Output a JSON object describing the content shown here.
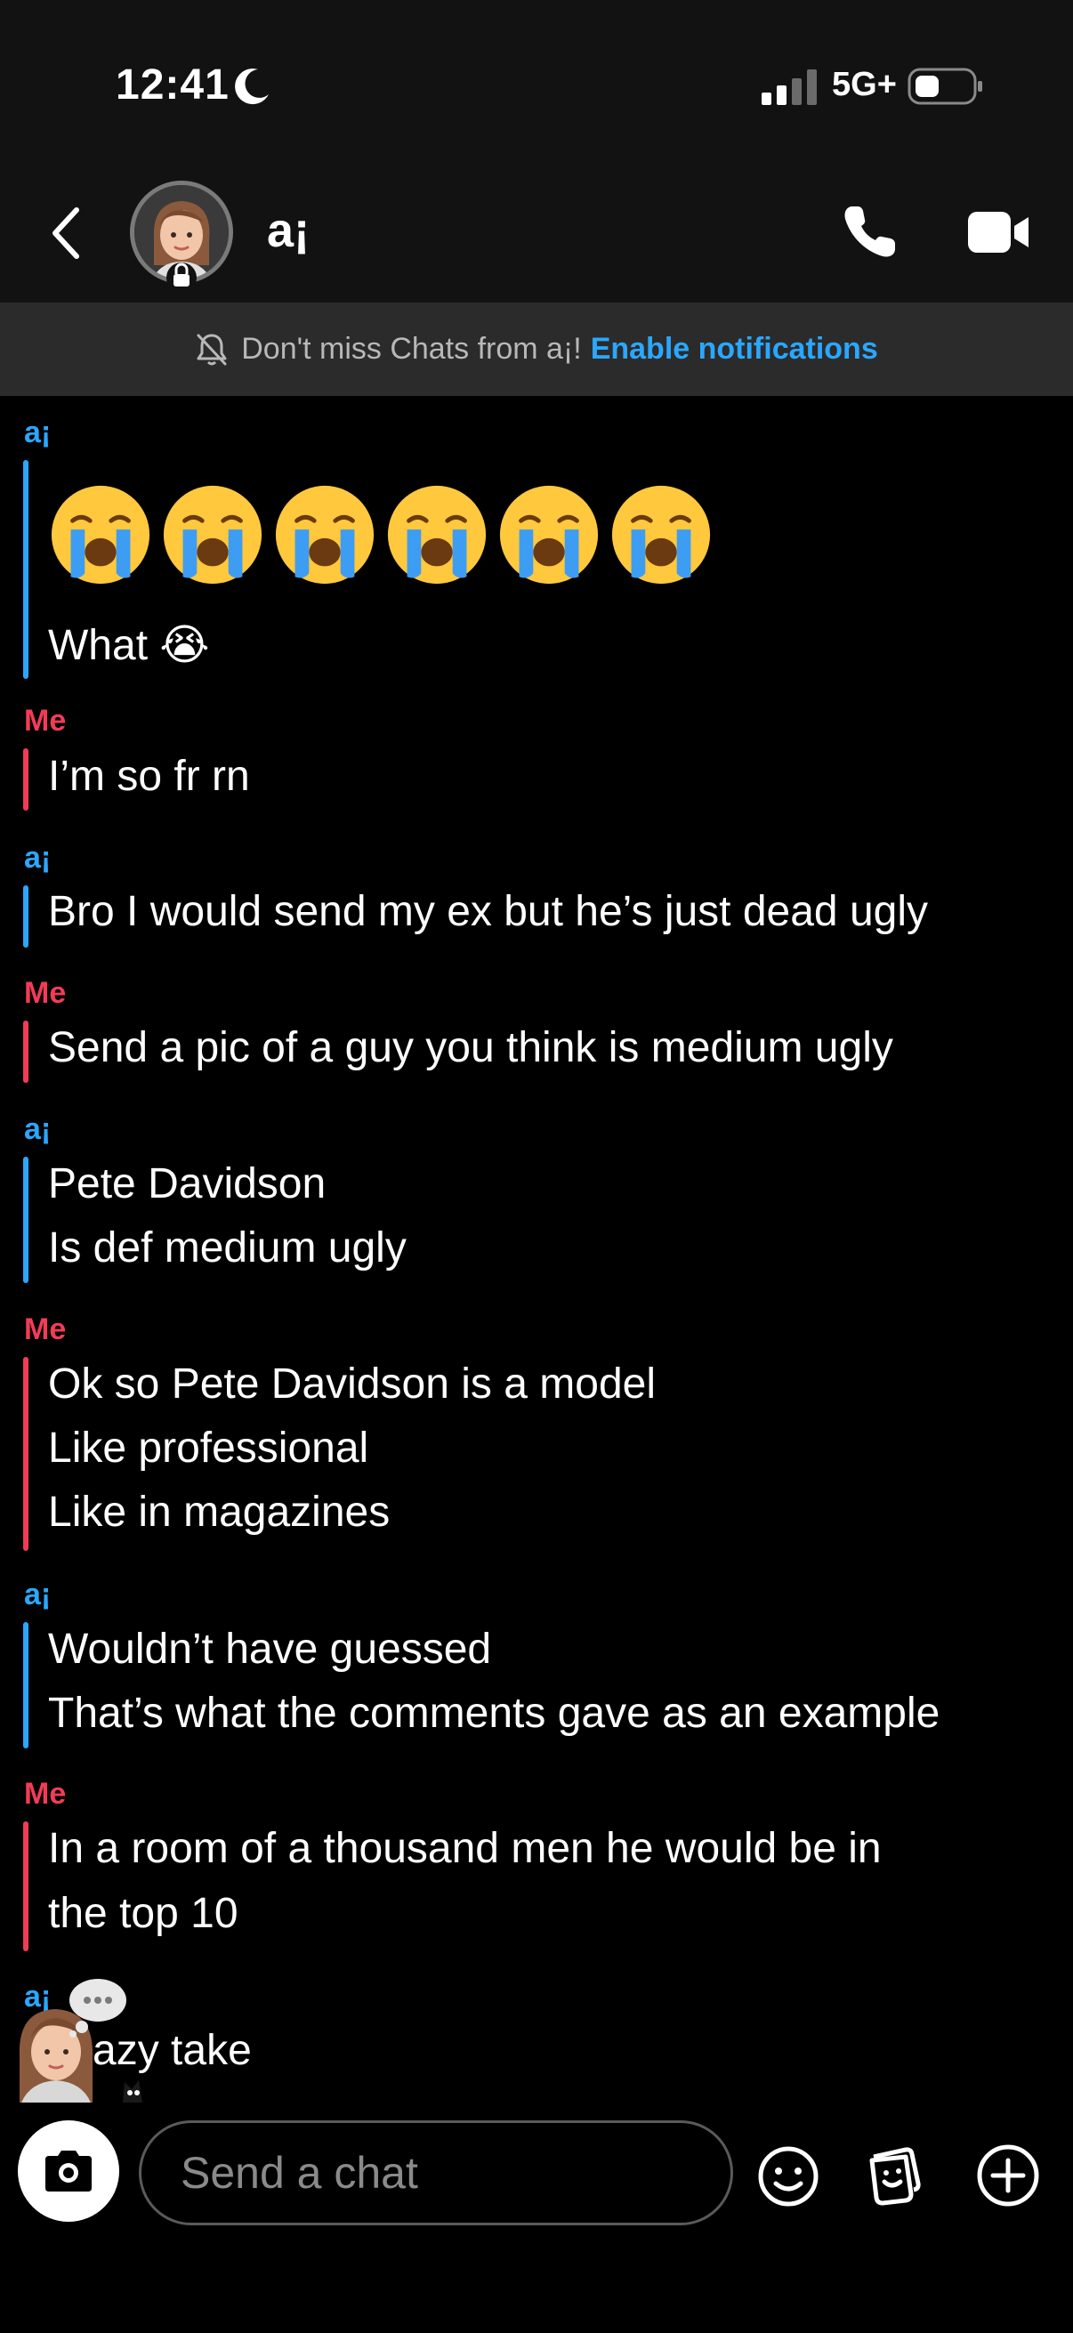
{
  "status_bar": {
    "time": "12:41",
    "network": "5G+"
  },
  "header": {
    "contact_name": "a¡"
  },
  "notification": {
    "text": "Don't miss Chats from a¡!",
    "link": "Enable notifications"
  },
  "messages": [
    {
      "sender": "a¡",
      "side": "them",
      "lines": [
        "What 😭"
      ],
      "emoji_count": 6
    },
    {
      "sender": "Me",
      "side": "me",
      "lines": [
        "I’m so fr rn"
      ]
    },
    {
      "sender": "a¡",
      "side": "them",
      "lines": [
        "Bro I would send my ex but he’s just dead ugly"
      ]
    },
    {
      "sender": "Me",
      "side": "me",
      "lines": [
        "Send a pic of a guy you think is medium ugly"
      ]
    },
    {
      "sender": "a¡",
      "side": "them",
      "lines": [
        "Pete Davidson",
        "Is def medium ugly"
      ]
    },
    {
      "sender": "Me",
      "side": "me",
      "lines": [
        "Ok so Pete Davidson is a model",
        "Like professional",
        "Like in magazines"
      ]
    },
    {
      "sender": "a¡",
      "side": "them",
      "lines": [
        "Wouldn’t have guessed",
        "That’s what the comments gave as an example"
      ]
    },
    {
      "sender": "Me",
      "side": "me",
      "lines": [
        "In a room of a thousand men he would be in",
        "the top 10"
      ]
    },
    {
      "sender": "a¡",
      "side": "them",
      "lines": [
        "azy take"
      ]
    }
  ],
  "composer": {
    "placeholder": "Send a chat"
  },
  "colors": {
    "them": "#2aa7ff",
    "me": "#f23c57",
    "link": "#2aa7ff"
  },
  "icons": [
    "moon-icon",
    "signal-icon",
    "battery-icon",
    "back-icon",
    "lock-icon",
    "phone-icon",
    "video-icon",
    "bell-off-icon",
    "crying-emoji",
    "camera-icon",
    "mic-icon",
    "smiley-icon",
    "sticker-icon",
    "plus-icon"
  ]
}
